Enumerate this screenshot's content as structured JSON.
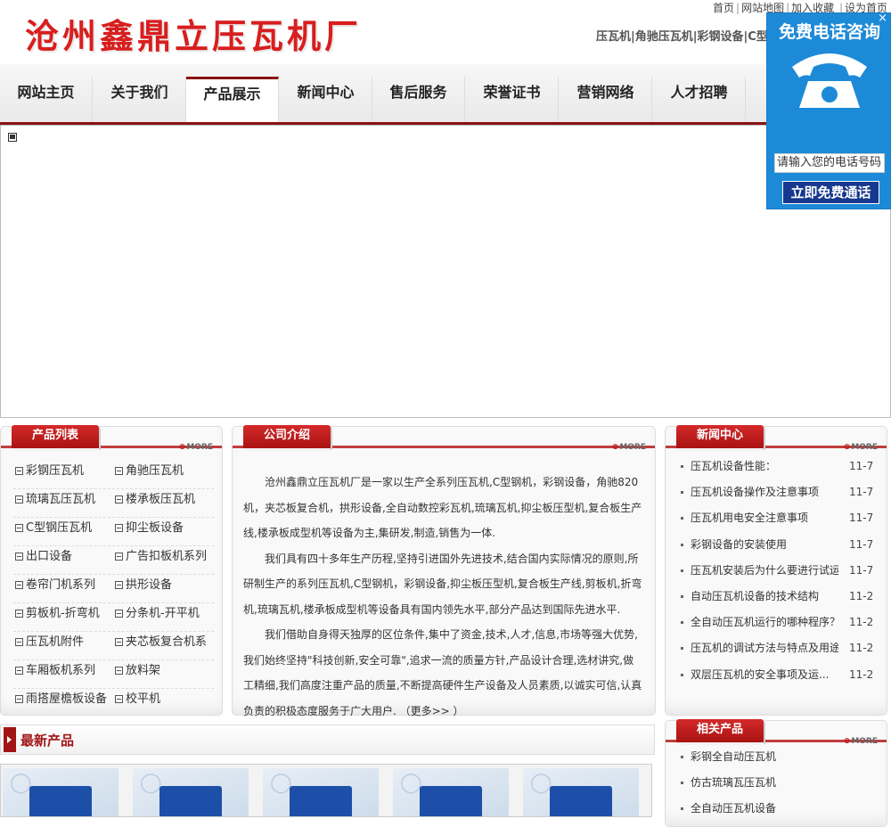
{
  "header": {
    "logo": "沧州鑫鼎立压瓦机厂",
    "toplinks": [
      "首页",
      "网站地图",
      "加入收藏",
      "设为首页"
    ],
    "keywords": "压瓦机|角驰压瓦机|彩钢设备|C型钢"
  },
  "nav": [
    "网站主页",
    "关于我们",
    "产品展示",
    "新闻中心",
    "售后服务",
    "荣誉证书",
    "营销网络",
    "人才招聘"
  ],
  "callbox": {
    "title": "免费电话咨询",
    "close": "×",
    "phone_placeholder": "请输入您的电话号码",
    "button": "立即免费通话"
  },
  "product_list": {
    "title": "产品列表",
    "more": "MORE",
    "rows": [
      [
        "彩钢压瓦机",
        "角驰压瓦机"
      ],
      [
        "琉璃瓦压瓦机",
        "楼承板压瓦机"
      ],
      [
        "C型钢压瓦机",
        "抑尘板设备"
      ],
      [
        "出口设备",
        "广告扣板机系列"
      ],
      [
        "卷帘门机系列",
        "拱形设备"
      ],
      [
        "剪板机-折弯机",
        "分条机-开平机"
      ],
      [
        "压瓦机附件",
        "夹芯板复合机系"
      ],
      [
        "车厢板机系列",
        "放料架"
      ],
      [
        "雨搭屋檐板设备",
        "校平机"
      ]
    ]
  },
  "about": {
    "title": "公司介绍",
    "more": "MORE",
    "paragraphs": [
      "沧州鑫鼎立压瓦机厂是一家以生产全系列压瓦机,C型钢机，彩钢设备，角驰820机，夹芯板复合机，拱形设备,全自动数控彩瓦机,琉璃瓦机,抑尘板压型机,复合板生产线,楼承板成型机等设备为主,集研发,制造,销售为一体.",
      "我们具有四十多年生产历程,坚持引进国外先进技术,结合国内实际情况的原则,所研制生产的系列压瓦机,C型钢机，彩钢设备,抑尘板压型机,复合板生产线,剪板机,折弯机,琉璃瓦机,楼承板成型机等设备具有国内领先水平,部分产品达到国际先进水平.",
      "我们借助自身得天独厚的区位条件,集中了资金,技术,人才,信息,市场等强大优势,我们始终坚持\"科技创新,安全可靠\",追求一流的质量方针,产品设计合理,选材讲究,做工精细,我们高度注重产品的质量,不断提高硬件生产设备及人员素质,以诚实可信,认真负责的积极态度服务于广大用户. （更多>> ）"
    ]
  },
  "news": {
    "title": "新闻中心",
    "more": "MORE",
    "items": [
      {
        "title": "压瓦机设备性能：",
        "date": "11-7"
      },
      {
        "title": "压瓦机设备操作及注意事项",
        "date": "11-7"
      },
      {
        "title": "压瓦机用电安全注意事项",
        "date": "11-7"
      },
      {
        "title": "彩钢设备的安装使用",
        "date": "11-7"
      },
      {
        "title": "压瓦机安装后为什么要进行试运转",
        "date": "11-7"
      },
      {
        "title": "自动压瓦机设备的技术结构",
        "date": "11-2"
      },
      {
        "title": "全自动压瓦机运行的哪种程序？",
        "date": "11-2"
      },
      {
        "title": "压瓦机的调试方法与特点及用途",
        "date": "11-2"
      },
      {
        "title": "双层压瓦机的安全事项及运...",
        "date": "11-2"
      }
    ]
  },
  "latest": {
    "title": "最新产品"
  },
  "related": {
    "title": "相关产品",
    "more": "MORE",
    "items": [
      "彩钢全自动压瓦机",
      "仿古琉璃瓦压瓦机",
      "全自动压瓦机设备"
    ]
  }
}
